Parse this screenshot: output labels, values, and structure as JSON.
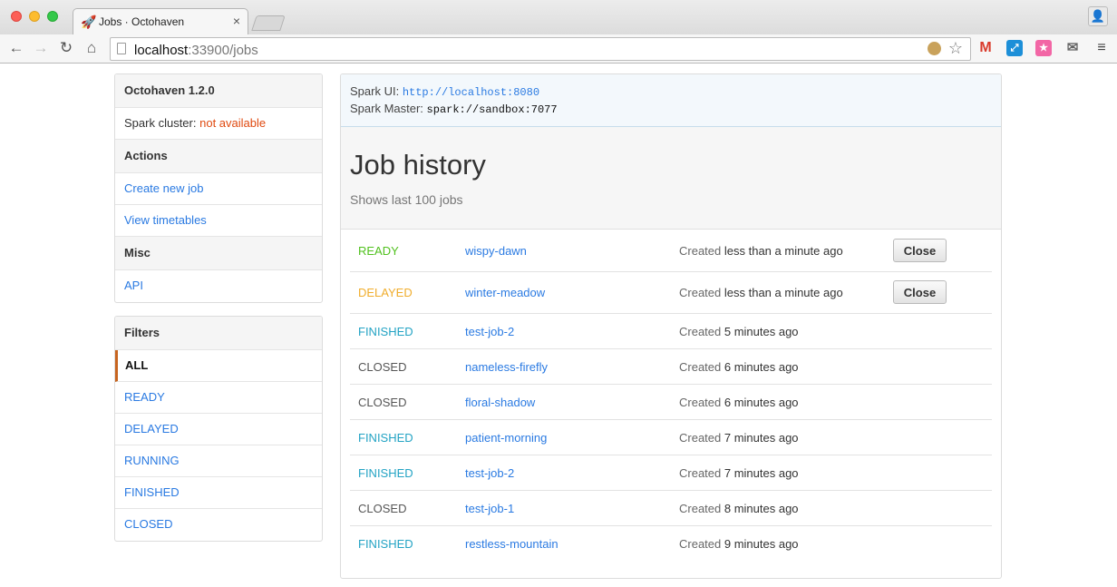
{
  "browser": {
    "tab_title": "Jobs · Octohaven",
    "tab_icon": "🚀",
    "url_host": "localhost",
    "url_rest": ":33900/jobs"
  },
  "sidebar": {
    "app_title": "Octohaven 1.2.0",
    "cluster_label": "Spark cluster:",
    "cluster_status": "not available",
    "actions_heading": "Actions",
    "actions": [
      "Create new job",
      "View timetables"
    ],
    "misc_heading": "Misc",
    "misc": [
      "API"
    ],
    "filters_heading": "Filters",
    "filters": [
      "ALL",
      "READY",
      "DELAYED",
      "RUNNING",
      "FINISHED",
      "CLOSED"
    ]
  },
  "info": {
    "ui_label": "Spark UI:",
    "ui_value": "http://localhost:8080",
    "master_label": "Spark Master:",
    "master_value": "spark://sandbox:7077"
  },
  "main": {
    "title": "Job history",
    "subtitle": "Shows last 100 jobs",
    "created_label": "Created",
    "close_label": "Close"
  },
  "jobs": [
    {
      "status": "READY",
      "name": "wispy-dawn",
      "age": "less than a minute ago",
      "closable": true
    },
    {
      "status": "DELAYED",
      "name": "winter-meadow",
      "age": "less than a minute ago",
      "closable": true
    },
    {
      "status": "FINISHED",
      "name": "test-job-2",
      "age": "5 minutes ago",
      "closable": false
    },
    {
      "status": "CLOSED",
      "name": "nameless-firefly",
      "age": "6 minutes ago",
      "closable": false
    },
    {
      "status": "CLOSED",
      "name": "floral-shadow",
      "age": "6 minutes ago",
      "closable": false
    },
    {
      "status": "FINISHED",
      "name": "patient-morning",
      "age": "7 minutes ago",
      "closable": false
    },
    {
      "status": "FINISHED",
      "name": "test-job-2",
      "age": "7 minutes ago",
      "closable": false
    },
    {
      "status": "CLOSED",
      "name": "test-job-1",
      "age": "8 minutes ago",
      "closable": false
    },
    {
      "status": "FINISHED",
      "name": "restless-mountain",
      "age": "9 minutes ago",
      "closable": false
    }
  ],
  "colors": {
    "ready": "#51c11f",
    "delayed": "#f0ad2c",
    "finished": "#23a3c4",
    "closed": "#555555",
    "link": "#2a7ae2",
    "not_available": "#e04a10"
  }
}
